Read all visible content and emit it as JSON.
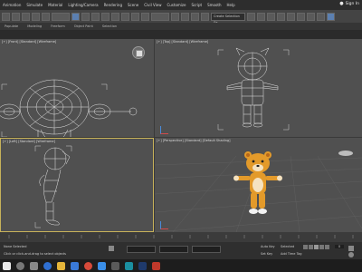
{
  "menubar": {
    "items": [
      "Animation",
      "Simulate",
      "Material",
      "Lighting/Camera",
      "Rendering",
      "Scene",
      "Civil View",
      "Customize",
      "Script",
      "Smooth",
      "Help"
    ],
    "sign_in": "Sign In"
  },
  "toolbar": {
    "selection_set": "Create Selection Se"
  },
  "subbar": {
    "items": [
      "Populate",
      "Modeling",
      "Freeform",
      "Object Paint",
      "Selection"
    ]
  },
  "viewports": {
    "front": {
      "label": "[+] [Front] [Standard] [Wireframe]"
    },
    "top": {
      "label": "[+] [Top] [Standard] [Wireframe]"
    },
    "left": {
      "label": "[+] [Left] [Standard] [Wireframe]"
    },
    "perspective": {
      "label": "[+] [Perspective] [Standard] [Default Shading]"
    }
  },
  "statusbar": {
    "selection": "None Selected",
    "prompt": "Click or click-and-drag to select objects",
    "key_mode": "Auto Key",
    "set_key": "Set Key",
    "add_time_tag": "Add Time Tag",
    "selected_label": "Selected",
    "frame": "0"
  },
  "colors": {
    "accent": "#5b7fb0",
    "viewport_bg": "#505050",
    "wire": "#e6e6e6",
    "active_border": "#c7b25a",
    "character_orange": "#e39a2a"
  },
  "taskbar": {
    "icons": [
      "start-icon",
      "search-icon",
      "task-view-icon",
      "edge-icon",
      "explorer-icon",
      "store-icon",
      "chrome-icon",
      "mail-icon",
      "media-icon",
      "3dsmax-icon",
      "photoshop-icon",
      "app-icon"
    ]
  }
}
